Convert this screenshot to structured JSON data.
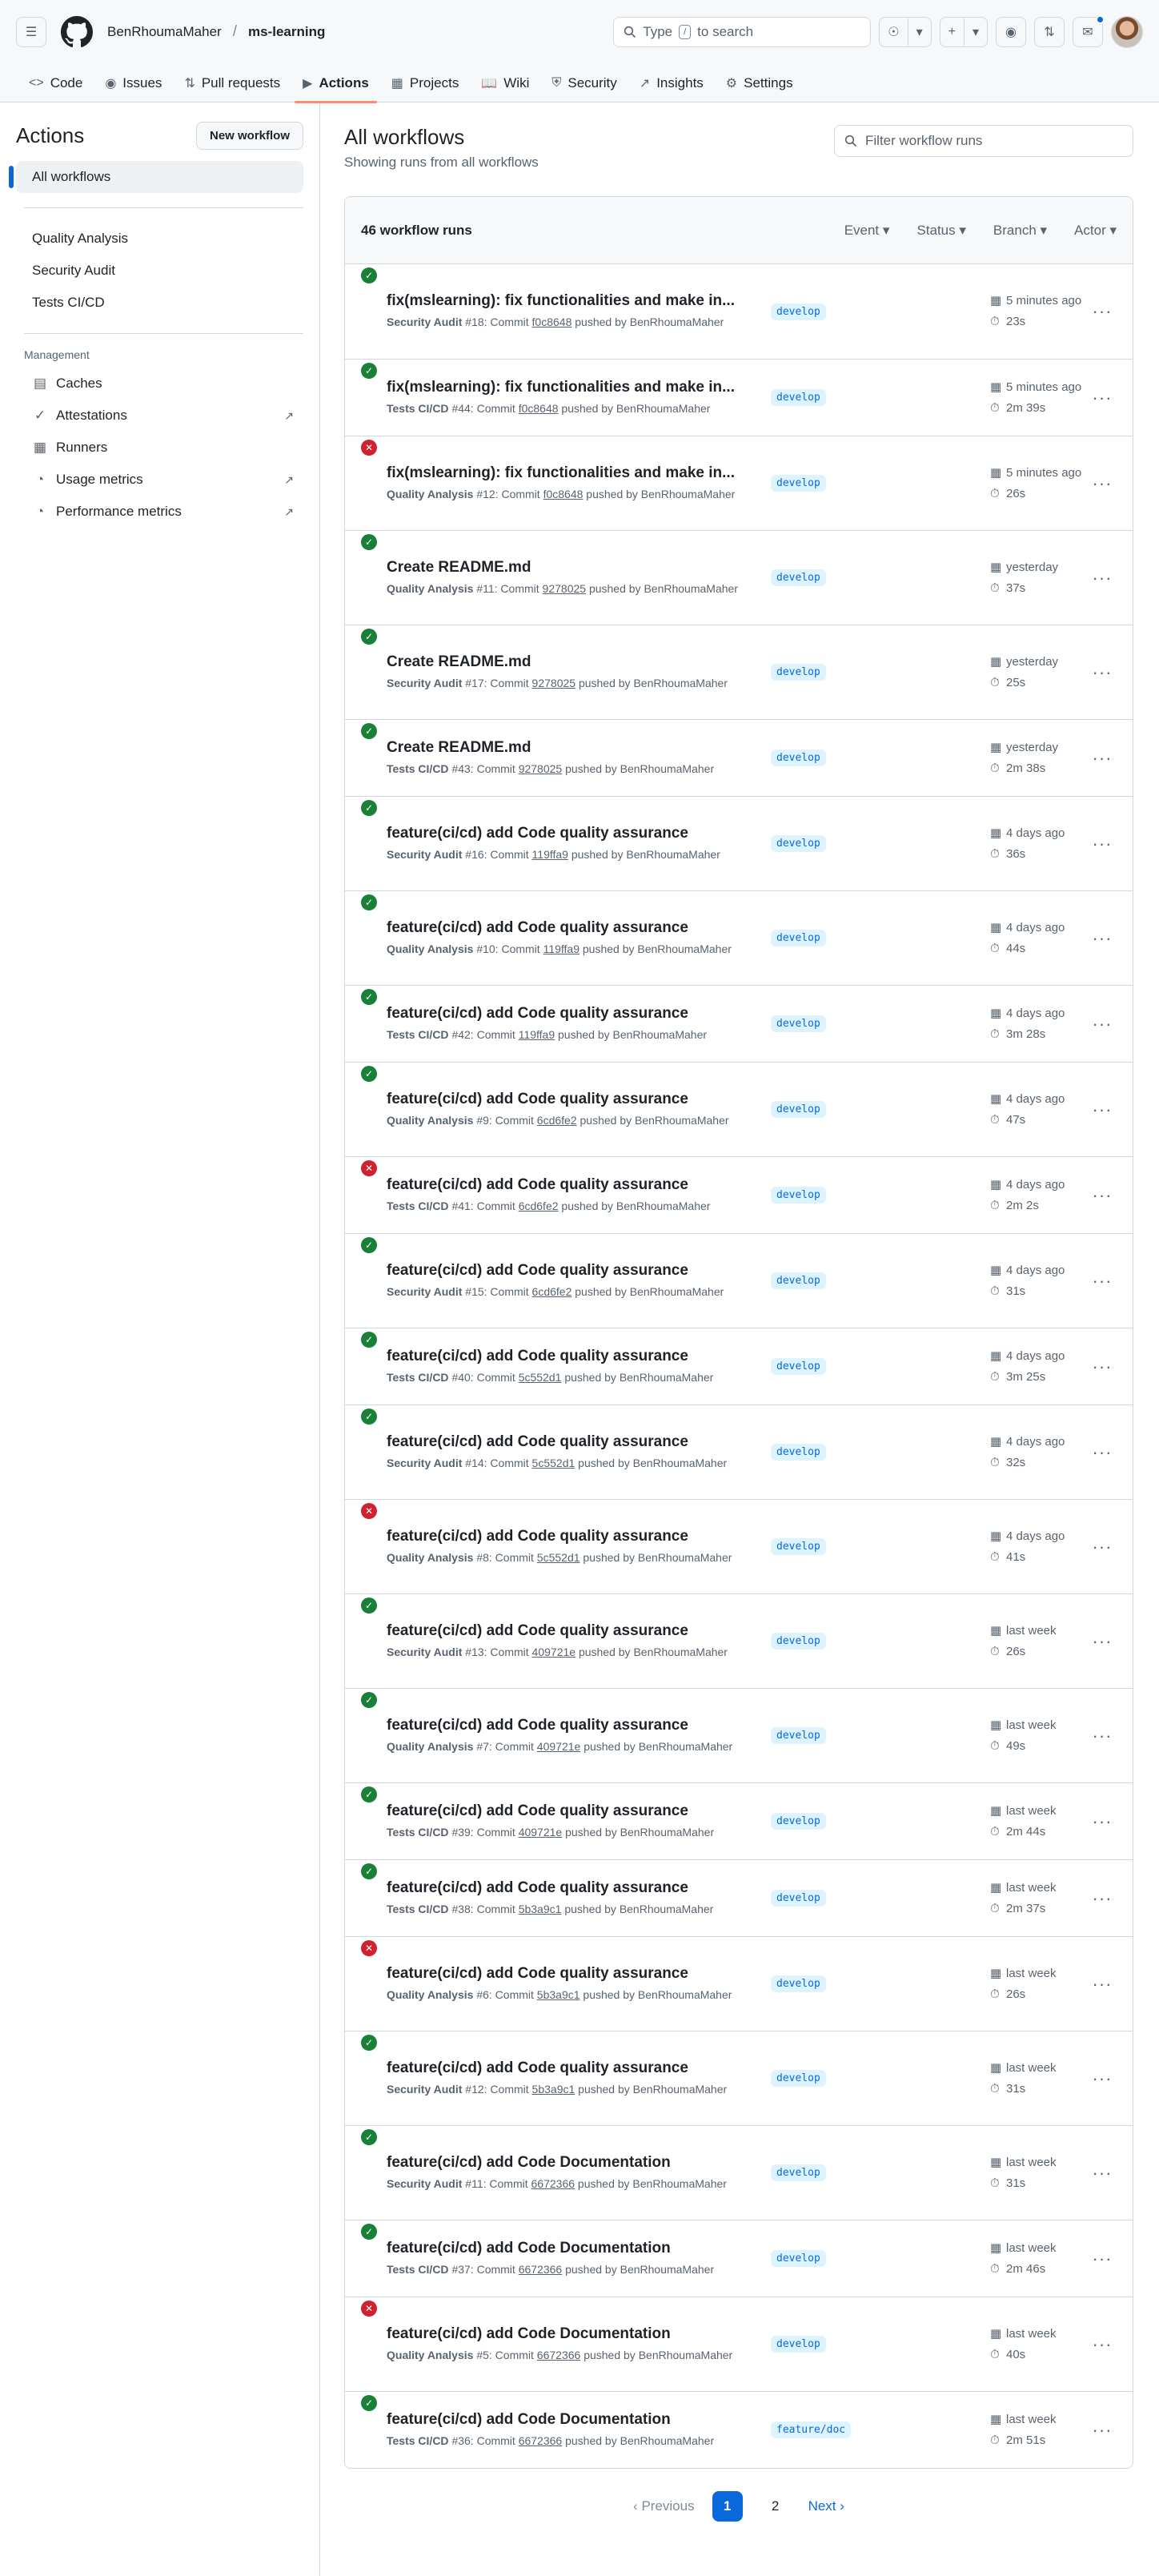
{
  "header": {
    "owner": "BenRhoumaMaher",
    "separator": "/",
    "repo": "ms-learning",
    "search_prefix": "Type",
    "search_key": "/",
    "search_suffix": "to search"
  },
  "tabs": [
    {
      "label": "Code",
      "icon": "code-icon"
    },
    {
      "label": "Issues",
      "icon": "issue-icon"
    },
    {
      "label": "Pull requests",
      "icon": "pull-request-icon"
    },
    {
      "label": "Actions",
      "icon": "play-icon"
    },
    {
      "label": "Projects",
      "icon": "table-icon"
    },
    {
      "label": "Wiki",
      "icon": "book-icon"
    },
    {
      "label": "Security",
      "icon": "shield-icon"
    },
    {
      "label": "Insights",
      "icon": "graph-icon"
    },
    {
      "label": "Settings",
      "icon": "gear-icon"
    }
  ],
  "sidebar": {
    "title": "Actions",
    "new_workflow": "New workflow",
    "all_workflows": "All workflows",
    "workflows": [
      "Quality Analysis",
      "Security Audit",
      "Tests CI/CD"
    ],
    "management_title": "Management",
    "management": [
      "Caches",
      "Attestations",
      "Runners",
      "Usage metrics",
      "Performance metrics"
    ]
  },
  "main": {
    "title": "All workflows",
    "subtitle": "Showing runs from all workflows",
    "filter_placeholder": "Filter workflow runs",
    "runs_count": "46 workflow runs",
    "filters": [
      "Event",
      "Status",
      "Branch",
      "Actor"
    ]
  },
  "runs": [
    {
      "status": "success",
      "title": "fix(mslearning): fix functionalities and make in...",
      "workflow": "Security Audit",
      "num": "#18",
      "sha": "f0c8648",
      "user": "BenRhoumaMaher",
      "branch": "develop",
      "when": "5 minutes ago",
      "duration": "23s"
    },
    {
      "status": "success",
      "title": "fix(mslearning): fix functionalities and make in...",
      "workflow": "Tests CI/CD",
      "num": "#44",
      "sha": "f0c8648",
      "user": "BenRhoumaMaher",
      "branch": "develop",
      "when": "5 minutes ago",
      "duration": "2m 39s"
    },
    {
      "status": "failure",
      "title": "fix(mslearning): fix functionalities and make in...",
      "workflow": "Quality Analysis",
      "num": "#12",
      "sha": "f0c8648",
      "user": "BenRhoumaMaher",
      "branch": "develop",
      "when": "5 minutes ago",
      "duration": "26s"
    },
    {
      "status": "success",
      "title": "Create README.md",
      "workflow": "Quality Analysis",
      "num": "#11",
      "sha": "9278025",
      "user": "BenRhoumaMaher",
      "branch": "develop",
      "when": "yesterday",
      "duration": "37s"
    },
    {
      "status": "success",
      "title": "Create README.md",
      "workflow": "Security Audit",
      "num": "#17",
      "sha": "9278025",
      "user": "BenRhoumaMaher",
      "branch": "develop",
      "when": "yesterday",
      "duration": "25s"
    },
    {
      "status": "success",
      "title": "Create README.md",
      "workflow": "Tests CI/CD",
      "num": "#43",
      "sha": "9278025",
      "user": "BenRhoumaMaher",
      "branch": "develop",
      "when": "yesterday",
      "duration": "2m 38s"
    },
    {
      "status": "success",
      "title": "feature(ci/cd) add Code quality assurance",
      "workflow": "Security Audit",
      "num": "#16",
      "sha": "119ffa9",
      "user": "BenRhoumaMaher",
      "branch": "develop",
      "when": "4 days ago",
      "duration": "36s"
    },
    {
      "status": "success",
      "title": "feature(ci/cd) add Code quality assurance",
      "workflow": "Quality Analysis",
      "num": "#10",
      "sha": "119ffa9",
      "user": "BenRhoumaMaher",
      "branch": "develop",
      "when": "4 days ago",
      "duration": "44s"
    },
    {
      "status": "success",
      "title": "feature(ci/cd) add Code quality assurance",
      "workflow": "Tests CI/CD",
      "num": "#42",
      "sha": "119ffa9",
      "user": "BenRhoumaMaher",
      "branch": "develop",
      "when": "4 days ago",
      "duration": "3m 28s"
    },
    {
      "status": "success",
      "title": "feature(ci/cd) add Code quality assurance",
      "workflow": "Quality Analysis",
      "num": "#9",
      "sha": "6cd6fe2",
      "user": "BenRhoumaMaher",
      "branch": "develop",
      "when": "4 days ago",
      "duration": "47s"
    },
    {
      "status": "failure",
      "title": "feature(ci/cd) add Code quality assurance",
      "workflow": "Tests CI/CD",
      "num": "#41",
      "sha": "6cd6fe2",
      "user": "BenRhoumaMaher",
      "branch": "develop",
      "when": "4 days ago",
      "duration": "2m 2s"
    },
    {
      "status": "success",
      "title": "feature(ci/cd) add Code quality assurance",
      "workflow": "Security Audit",
      "num": "#15",
      "sha": "6cd6fe2",
      "user": "BenRhoumaMaher",
      "branch": "develop",
      "when": "4 days ago",
      "duration": "31s"
    },
    {
      "status": "success",
      "title": "feature(ci/cd) add Code quality assurance",
      "workflow": "Tests CI/CD",
      "num": "#40",
      "sha": "5c552d1",
      "user": "BenRhoumaMaher",
      "branch": "develop",
      "when": "4 days ago",
      "duration": "3m 25s"
    },
    {
      "status": "success",
      "title": "feature(ci/cd) add Code quality assurance",
      "workflow": "Security Audit",
      "num": "#14",
      "sha": "5c552d1",
      "user": "BenRhoumaMaher",
      "branch": "develop",
      "when": "4 days ago",
      "duration": "32s"
    },
    {
      "status": "failure",
      "title": "feature(ci/cd) add Code quality assurance",
      "workflow": "Quality Analysis",
      "num": "#8",
      "sha": "5c552d1",
      "user": "BenRhoumaMaher",
      "branch": "develop",
      "when": "4 days ago",
      "duration": "41s"
    },
    {
      "status": "success",
      "title": "feature(ci/cd) add Code quality assurance",
      "workflow": "Security Audit",
      "num": "#13",
      "sha": "409721e",
      "user": "BenRhoumaMaher",
      "branch": "develop",
      "when": "last week",
      "duration": "26s"
    },
    {
      "status": "success",
      "title": "feature(ci/cd) add Code quality assurance",
      "workflow": "Quality Analysis",
      "num": "#7",
      "sha": "409721e",
      "user": "BenRhoumaMaher",
      "branch": "develop",
      "when": "last week",
      "duration": "49s"
    },
    {
      "status": "success",
      "title": "feature(ci/cd) add Code quality assurance",
      "workflow": "Tests CI/CD",
      "num": "#39",
      "sha": "409721e",
      "user": "BenRhoumaMaher",
      "branch": "develop",
      "when": "last week",
      "duration": "2m 44s"
    },
    {
      "status": "success",
      "title": "feature(ci/cd) add Code quality assurance",
      "workflow": "Tests CI/CD",
      "num": "#38",
      "sha": "5b3a9c1",
      "user": "BenRhoumaMaher",
      "branch": "develop",
      "when": "last week",
      "duration": "2m 37s"
    },
    {
      "status": "failure",
      "title": "feature(ci/cd) add Code quality assurance",
      "workflow": "Quality Analysis",
      "num": "#6",
      "sha": "5b3a9c1",
      "user": "BenRhoumaMaher",
      "branch": "develop",
      "when": "last week",
      "duration": "26s"
    },
    {
      "status": "success",
      "title": "feature(ci/cd) add Code quality assurance",
      "workflow": "Security Audit",
      "num": "#12",
      "sha": "5b3a9c1",
      "user": "BenRhoumaMaher",
      "branch": "develop",
      "when": "last week",
      "duration": "31s"
    },
    {
      "status": "success",
      "title": "feature(ci/cd) add Code Documentation",
      "workflow": "Security Audit",
      "num": "#11",
      "sha": "6672366",
      "user": "BenRhoumaMaher",
      "branch": "develop",
      "when": "last week",
      "duration": "31s"
    },
    {
      "status": "success",
      "title": "feature(ci/cd) add Code Documentation",
      "workflow": "Tests CI/CD",
      "num": "#37",
      "sha": "6672366",
      "user": "BenRhoumaMaher",
      "branch": "develop",
      "when": "last week",
      "duration": "2m 46s"
    },
    {
      "status": "failure",
      "title": "feature(ci/cd) add Code Documentation",
      "workflow": "Quality Analysis",
      "num": "#5",
      "sha": "6672366",
      "user": "BenRhoumaMaher",
      "branch": "develop",
      "when": "last week",
      "duration": "40s"
    },
    {
      "status": "success",
      "title": "feature(ci/cd) add Code Documentation",
      "workflow": "Tests CI/CD",
      "num": "#36",
      "sha": "6672366",
      "user": "BenRhoumaMaher",
      "branch": "feature/doc",
      "when": "last week",
      "duration": "2m 51s"
    }
  ],
  "run_text": {
    "commit": "Commit",
    "pushed_by": "pushed by"
  },
  "pagination": {
    "prev": "Previous",
    "pages": [
      "1",
      "2"
    ],
    "current": "1",
    "next": "Next"
  },
  "colors": {
    "success": "#1a7f37",
    "failure": "#cf222e",
    "accent": "#0969da",
    "tab_underline": "#fd8c73"
  }
}
